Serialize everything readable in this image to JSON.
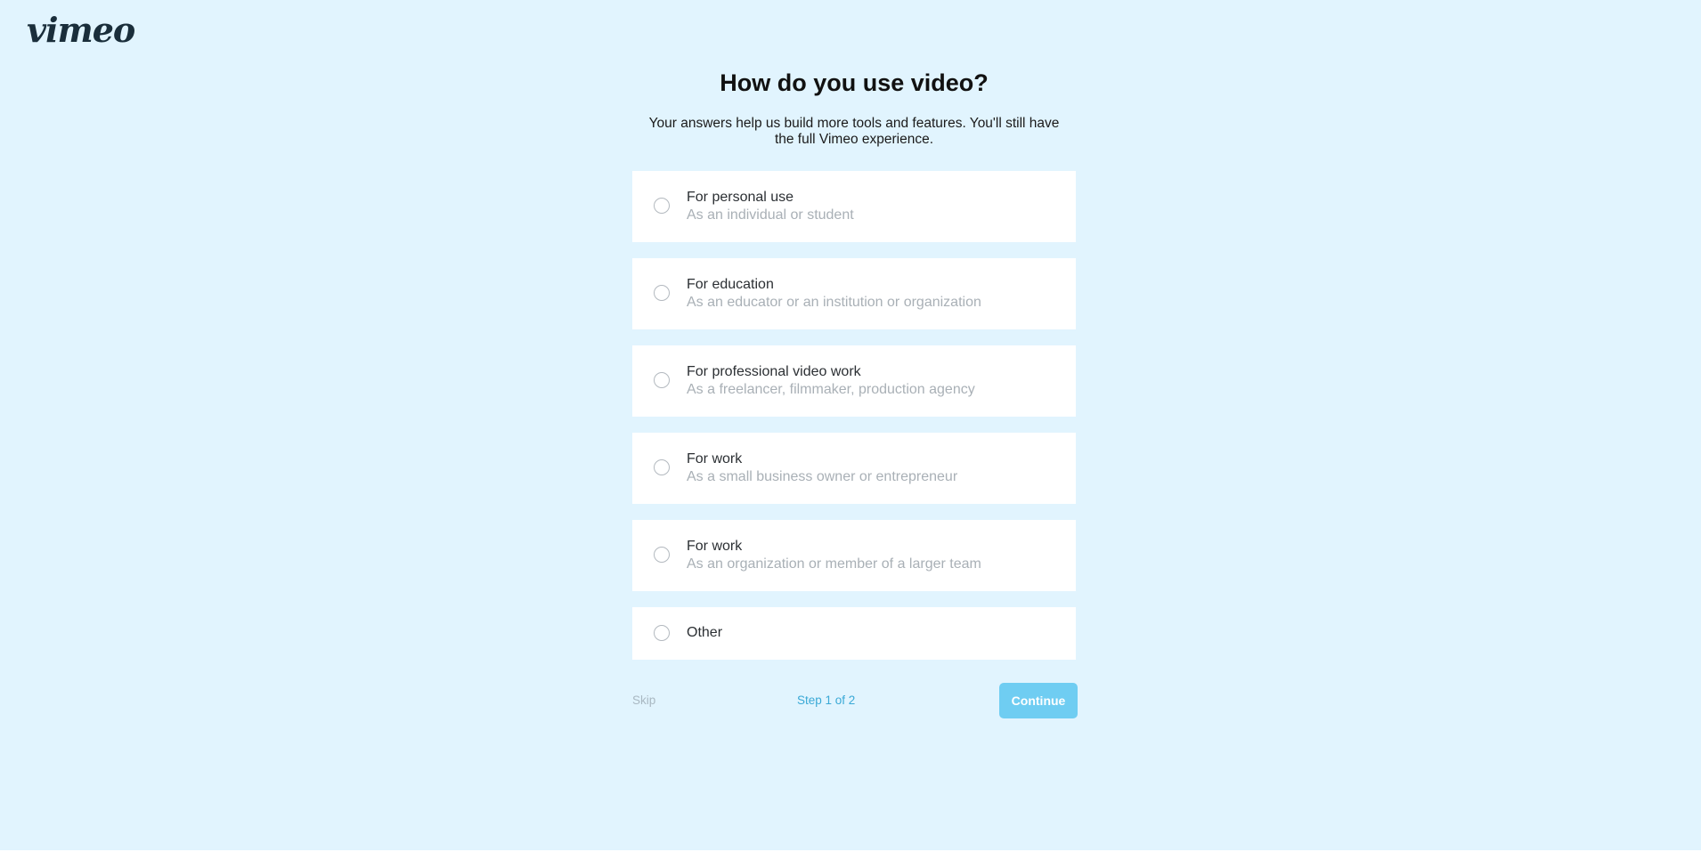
{
  "brand": {
    "logo_text": "vimeo"
  },
  "header": {
    "title": "How do you use video?",
    "subtitle_line1": "Your answers help us build more tools and features. You'll still have",
    "subtitle_line2": "the full Vimeo experience."
  },
  "options": [
    {
      "label": "For personal use",
      "description": "As an individual or student"
    },
    {
      "label": "For education",
      "description": "As an educator or an institution or organization"
    },
    {
      "label": "For professional video work",
      "description": "As a freelancer, filmmaker, production agency"
    },
    {
      "label": "For work",
      "description": "As a small business owner or entrepreneur"
    },
    {
      "label": "For work",
      "description": "As an organization or member of a larger team"
    },
    {
      "label": "Other"
    }
  ],
  "footer": {
    "skip_label": "Skip",
    "step_text": "Step 1 of 2",
    "continue_label": "Continue"
  },
  "colors": {
    "background": "#e1f4fe",
    "continue_button": "#6fcdf2",
    "step_text": "#3aa9d6",
    "logo": "#1a2e3b"
  },
  "icons": {
    "option_selector": "radio-unchecked-icon"
  }
}
